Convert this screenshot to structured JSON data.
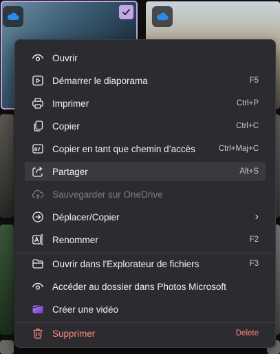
{
  "menu": {
    "items": [
      {
        "label": "Ouvrir",
        "shortcut": "",
        "icon": "eye-icon"
      },
      {
        "label": "Démarrer le diaporama",
        "shortcut": "F5",
        "icon": "slideshow-icon"
      },
      {
        "label": "Imprimer",
        "shortcut": "Ctrl+P",
        "icon": "printer-icon"
      },
      {
        "label": "Copier",
        "shortcut": "Ctrl+C",
        "icon": "copy-icon"
      },
      {
        "label": "Copier en tant que chemin d’accès",
        "shortcut": "Ctrl+Maj+C",
        "icon": "copy-path-icon"
      },
      {
        "label": "Partager",
        "shortcut": "Alt+S",
        "icon": "share-icon"
      },
      {
        "label": "Sauvegarder sur OneDrive",
        "shortcut": "",
        "icon": "cloud-upload-icon"
      },
      {
        "label": "Déplacer/Copier",
        "shortcut": "",
        "icon": "move-icon"
      },
      {
        "label": "Renommer",
        "shortcut": "F2",
        "icon": "rename-icon"
      },
      {
        "label": "Ouvrir dans l'Explorateur de fichiers",
        "shortcut": "F3",
        "icon": "folder-icon"
      },
      {
        "label": "Accéder au dossier dans Photos Microsoft",
        "shortcut": "",
        "icon": "eye-icon"
      },
      {
        "label": "Créer une vidéo",
        "shortcut": "",
        "icon": "clipchamp-icon"
      },
      {
        "label": "Supprimer",
        "shortcut": "Delete",
        "icon": "trash-icon"
      }
    ],
    "submenu_glyph": "›",
    "colors": {
      "accent": "#c6a7e6",
      "danger": "#ff8a80",
      "menu_bg": "#2c2b2f"
    }
  }
}
